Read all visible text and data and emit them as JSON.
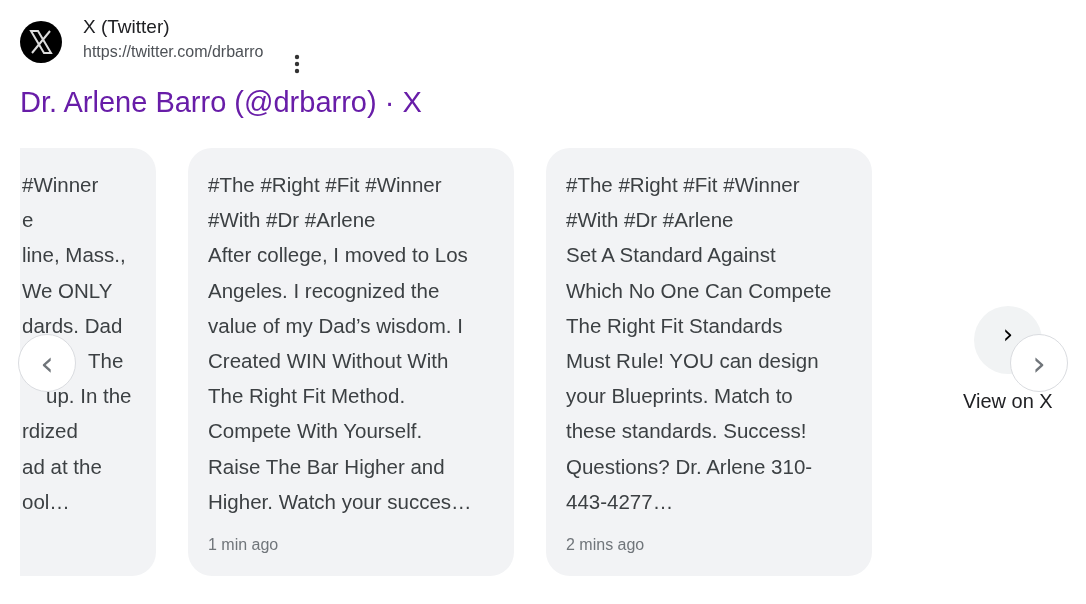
{
  "source": {
    "site_name": "X (Twitter)",
    "url": "https://twitter.com/drbarro"
  },
  "result_title": "Dr. Arlene Barro (@drbarro) · X",
  "carousel": {
    "previous_button": "‹",
    "cards": [
      {
        "kind": "partial",
        "lines": [
          "#Winner",
          "e",
          "line, Mass.,",
          "We ONLY",
          "dards. Dad",
          "The",
          "up. In the",
          "rdized",
          "ad at the",
          "ool…"
        ]
      },
      {
        "kind": "post",
        "lines": [
          "#The #Right #Fit #Winner",
          "#With #Dr #Arlene",
          "After college, I moved to Los",
          "Angeles. I recognized the",
          "value of my Dad’s wisdom. I",
          "Created WIN Without With",
          "The Right Fit Method.",
          "Compete With Yourself.",
          "Raise The Bar Higher and",
          "Higher. Watch your succes…"
        ],
        "time": "1 min ago"
      },
      {
        "kind": "post",
        "lines": [
          "#The #Right #Fit #Winner",
          "#With #Dr #Arlene",
          "Set A Standard Against",
          "Which No One Can Compete",
          "The Right Fit Standards",
          "Must Rule! YOU can design",
          "your Blueprints. Match to",
          "these standards. Success!",
          "Questions? Dr. Arlene 310-",
          "443-4277…"
        ],
        "time": "2 mins ago"
      }
    ],
    "view_more": {
      "arrow": "›",
      "label": "View on X"
    },
    "next_button": "›"
  }
}
